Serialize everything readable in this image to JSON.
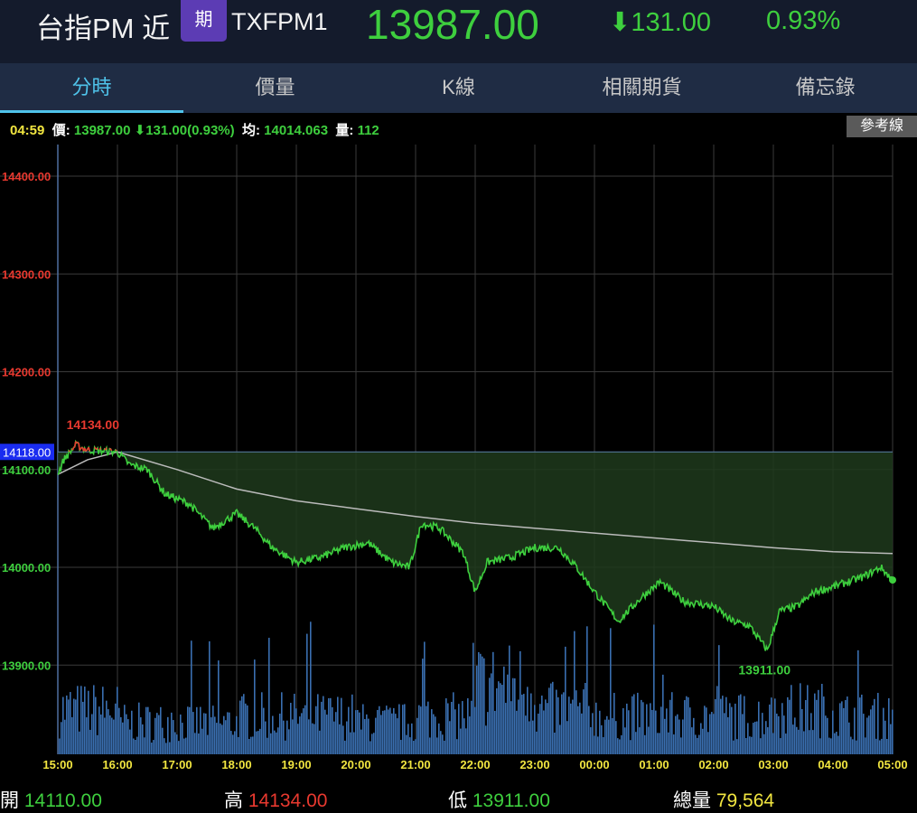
{
  "header": {
    "name": "台指PM 近",
    "badge": "期",
    "code": "TXFPM1",
    "price": "13987.00",
    "change": "131.00",
    "change_icon": "arrow-down",
    "percent": "0.93%"
  },
  "tabs": [
    {
      "label": "分時"
    },
    {
      "label": "價量"
    },
    {
      "label": "K線"
    },
    {
      "label": "相關期貨"
    },
    {
      "label": "備忘錄"
    }
  ],
  "info": {
    "time": "04:59",
    "price_label": "價:",
    "price": "13987.00",
    "change": "131.00(0.93%)",
    "avg_label": "均:",
    "avg": "14014.063",
    "vol_label": "量:",
    "vol": "112",
    "ref_button": "參考線"
  },
  "footer": {
    "open_label": "開",
    "open": "14110.00",
    "high_label": "高",
    "high": "14134.00",
    "low_label": "低",
    "low": "13911.00",
    "total_label": "總量",
    "total": "79,564"
  },
  "colors": {
    "up": "#e8392f",
    "down": "#3ecf3e",
    "volume": "#3a6fb0",
    "avg": "#bbbbbb",
    "time": "#f2e640"
  },
  "chart_data": {
    "type": "line",
    "y_ticks": [
      "14400.00",
      "14300.00",
      "14200.00",
      "14100.00",
      "14000.00",
      "13900.00"
    ],
    "y_tick_values": [
      14400,
      14300,
      14200,
      14100,
      14000,
      13900
    ],
    "x_ticks": [
      "15:00",
      "16:00",
      "17:00",
      "18:00",
      "19:00",
      "20:00",
      "21:00",
      "22:00",
      "23:00",
      "00:00",
      "01:00",
      "02:00",
      "03:00",
      "04:00",
      "05:00"
    ],
    "reference": {
      "value": 14118,
      "label": "14118.00"
    },
    "high": {
      "value": 14134,
      "label": "14134.00",
      "hour": 0.6
    },
    "low": {
      "value": 13911,
      "label": "13911.00",
      "hour": 11.9
    },
    "price_series": [
      [
        0,
        14095
      ],
      [
        0.1,
        14110
      ],
      [
        0.3,
        14125
      ],
      [
        0.5,
        14120
      ],
      [
        1.0,
        14118
      ],
      [
        1.2,
        14105
      ],
      [
        1.5,
        14100
      ],
      [
        1.8,
        14075
      ],
      [
        2.2,
        14065
      ],
      [
        2.6,
        14040
      ],
      [
        3.0,
        14055
      ],
      [
        3.3,
        14040
      ],
      [
        3.6,
        14020
      ],
      [
        4.0,
        14005
      ],
      [
        4.4,
        14010
      ],
      [
        4.8,
        14020
      ],
      [
        5.2,
        14025
      ],
      [
        5.6,
        14005
      ],
      [
        5.9,
        14000
      ],
      [
        6.1,
        14045
      ],
      [
        6.4,
        14040
      ],
      [
        6.8,
        14015
      ],
      [
        7.0,
        13975
      ],
      [
        7.2,
        14005
      ],
      [
        7.6,
        14010
      ],
      [
        8.0,
        14020
      ],
      [
        8.4,
        14020
      ],
      [
        8.7,
        14000
      ],
      [
        9.0,
        13975
      ],
      [
        9.4,
        13945
      ],
      [
        9.8,
        13970
      ],
      [
        10.1,
        13985
      ],
      [
        10.5,
        13965
      ],
      [
        11.0,
        13960
      ],
      [
        11.3,
        13945
      ],
      [
        11.6,
        13940
      ],
      [
        11.9,
        13915
      ],
      [
        12.1,
        13955
      ],
      [
        12.4,
        13960
      ],
      [
        12.7,
        13975
      ],
      [
        13.0,
        13980
      ],
      [
        13.5,
        13990
      ],
      [
        13.8,
        14000
      ],
      [
        14,
        13987
      ]
    ],
    "avg_series": [
      [
        0,
        14095
      ],
      [
        0.5,
        14110
      ],
      [
        1.0,
        14118
      ],
      [
        2.0,
        14100
      ],
      [
        3.0,
        14080
      ],
      [
        4.0,
        14068
      ],
      [
        5.0,
        14060
      ],
      [
        6.0,
        14052
      ],
      [
        7.0,
        14045
      ],
      [
        8.0,
        14040
      ],
      [
        9.0,
        14035
      ],
      [
        10.0,
        14030
      ],
      [
        11.0,
        14025
      ],
      [
        12.0,
        14020
      ],
      [
        13.0,
        14016
      ],
      [
        14,
        14014
      ]
    ],
    "volume_hourly_level": [
      0.35,
      0.25,
      0.25,
      0.3,
      0.3,
      0.25,
      0.3,
      0.55,
      0.35,
      0.3,
      0.3,
      0.3,
      0.35,
      0.3
    ]
  }
}
